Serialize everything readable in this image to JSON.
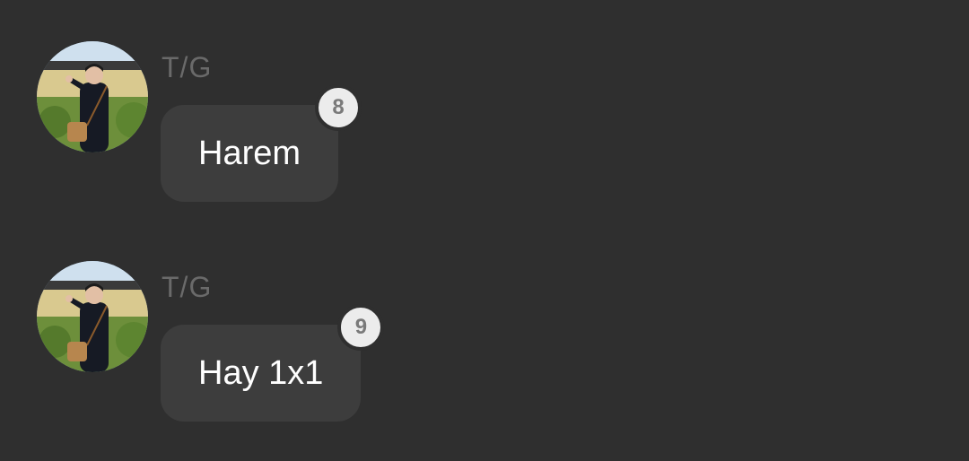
{
  "messages": [
    {
      "sender": "T/G",
      "text": "Harem",
      "badge": "8",
      "avatar": "profile-photo"
    },
    {
      "sender": "T/G",
      "text": "Hay 1x1",
      "badge": "9",
      "avatar": "profile-photo"
    }
  ],
  "colors": {
    "background": "#2f2f2f",
    "bubble": "#3d3d3d",
    "sender_text": "#6a6a6a",
    "message_text": "#ffffff",
    "badge_bg": "#ececec",
    "badge_text": "#7a7a7a"
  }
}
